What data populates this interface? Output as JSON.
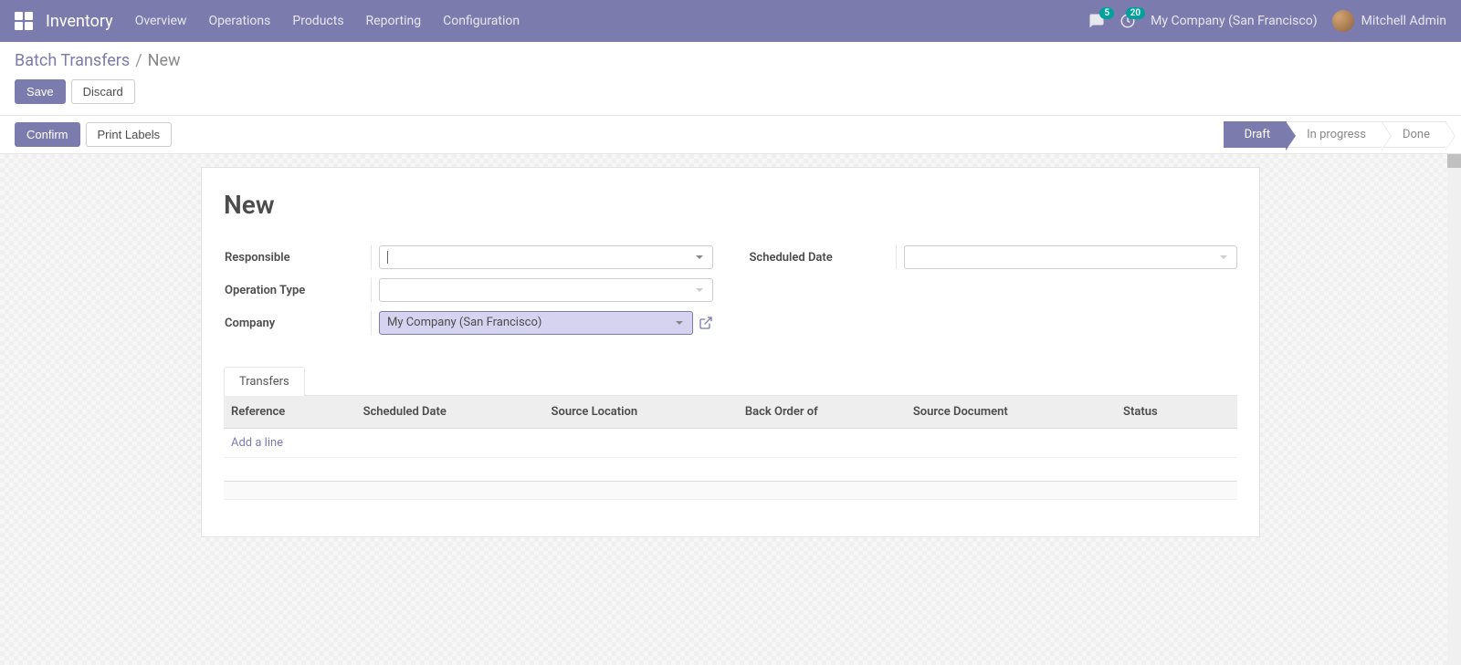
{
  "nav": {
    "brand": "Inventory",
    "menu": [
      "Overview",
      "Operations",
      "Products",
      "Reporting",
      "Configuration"
    ],
    "discuss_badge": "5",
    "activity_badge": "20",
    "company": "My Company (San Francisco)",
    "user": "Mitchell Admin"
  },
  "breadcrumb": {
    "parent": "Batch Transfers",
    "current": "New"
  },
  "buttons": {
    "save": "Save",
    "discard": "Discard",
    "confirm": "Confirm",
    "print_labels": "Print Labels"
  },
  "statusbar": [
    "Draft",
    "In progress",
    "Done"
  ],
  "statusbar_active": 0,
  "title": "New",
  "form": {
    "responsible": {
      "label": "Responsible",
      "value": ""
    },
    "operation_type": {
      "label": "Operation Type",
      "value": ""
    },
    "company": {
      "label": "Company",
      "value": "My Company (San Francisco)"
    },
    "scheduled_date": {
      "label": "Scheduled Date",
      "value": ""
    }
  },
  "tabs": [
    "Transfers"
  ],
  "columns": [
    "Reference",
    "Scheduled Date",
    "Source Location",
    "Back Order of",
    "Source Document",
    "Status"
  ],
  "add_line": "Add a line"
}
